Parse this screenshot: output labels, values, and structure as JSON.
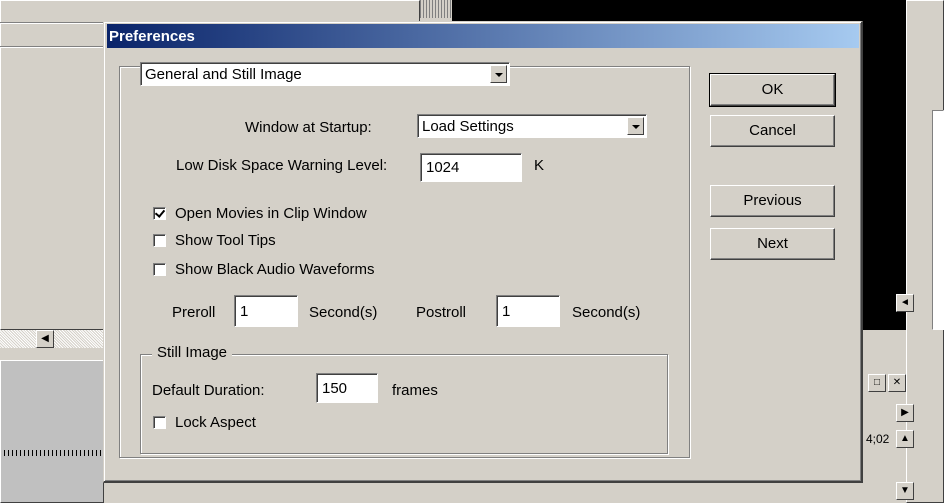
{
  "dialog": {
    "title": "Preferences",
    "category_select": "General and Still Image",
    "window_at_startup_label": "Window at Startup:",
    "window_at_startup_value": "Load Settings",
    "low_disk_label": "Low Disk Space Warning Level:",
    "low_disk_value": "1024",
    "low_disk_unit": "K",
    "checkboxes": [
      {
        "label": "Open Movies in Clip Window",
        "checked": true
      },
      {
        "label": "Show Tool Tips",
        "checked": false
      },
      {
        "label": "Show Black Audio Waveforms",
        "checked": false
      }
    ],
    "preroll_label": "Preroll",
    "preroll_value": "1",
    "preroll_unit": "Second(s)",
    "postroll_label": "Postroll",
    "postroll_value": "1",
    "postroll_unit": "Second(s)",
    "still_image": {
      "legend": "Still Image",
      "default_duration_label": "Default Duration:",
      "default_duration_value": "150",
      "default_duration_unit": "frames",
      "lock_aspect_label": "Lock Aspect",
      "lock_aspect_checked": false
    },
    "buttons": {
      "ok": "OK",
      "cancel": "Cancel",
      "previous": "Previous",
      "next": "Next"
    }
  },
  "background": {
    "timecode_text": "4;02"
  },
  "colors": {
    "titlebar_start": "#0a246a",
    "titlebar_end": "#a6caf0",
    "face": "#d4d0c8"
  }
}
